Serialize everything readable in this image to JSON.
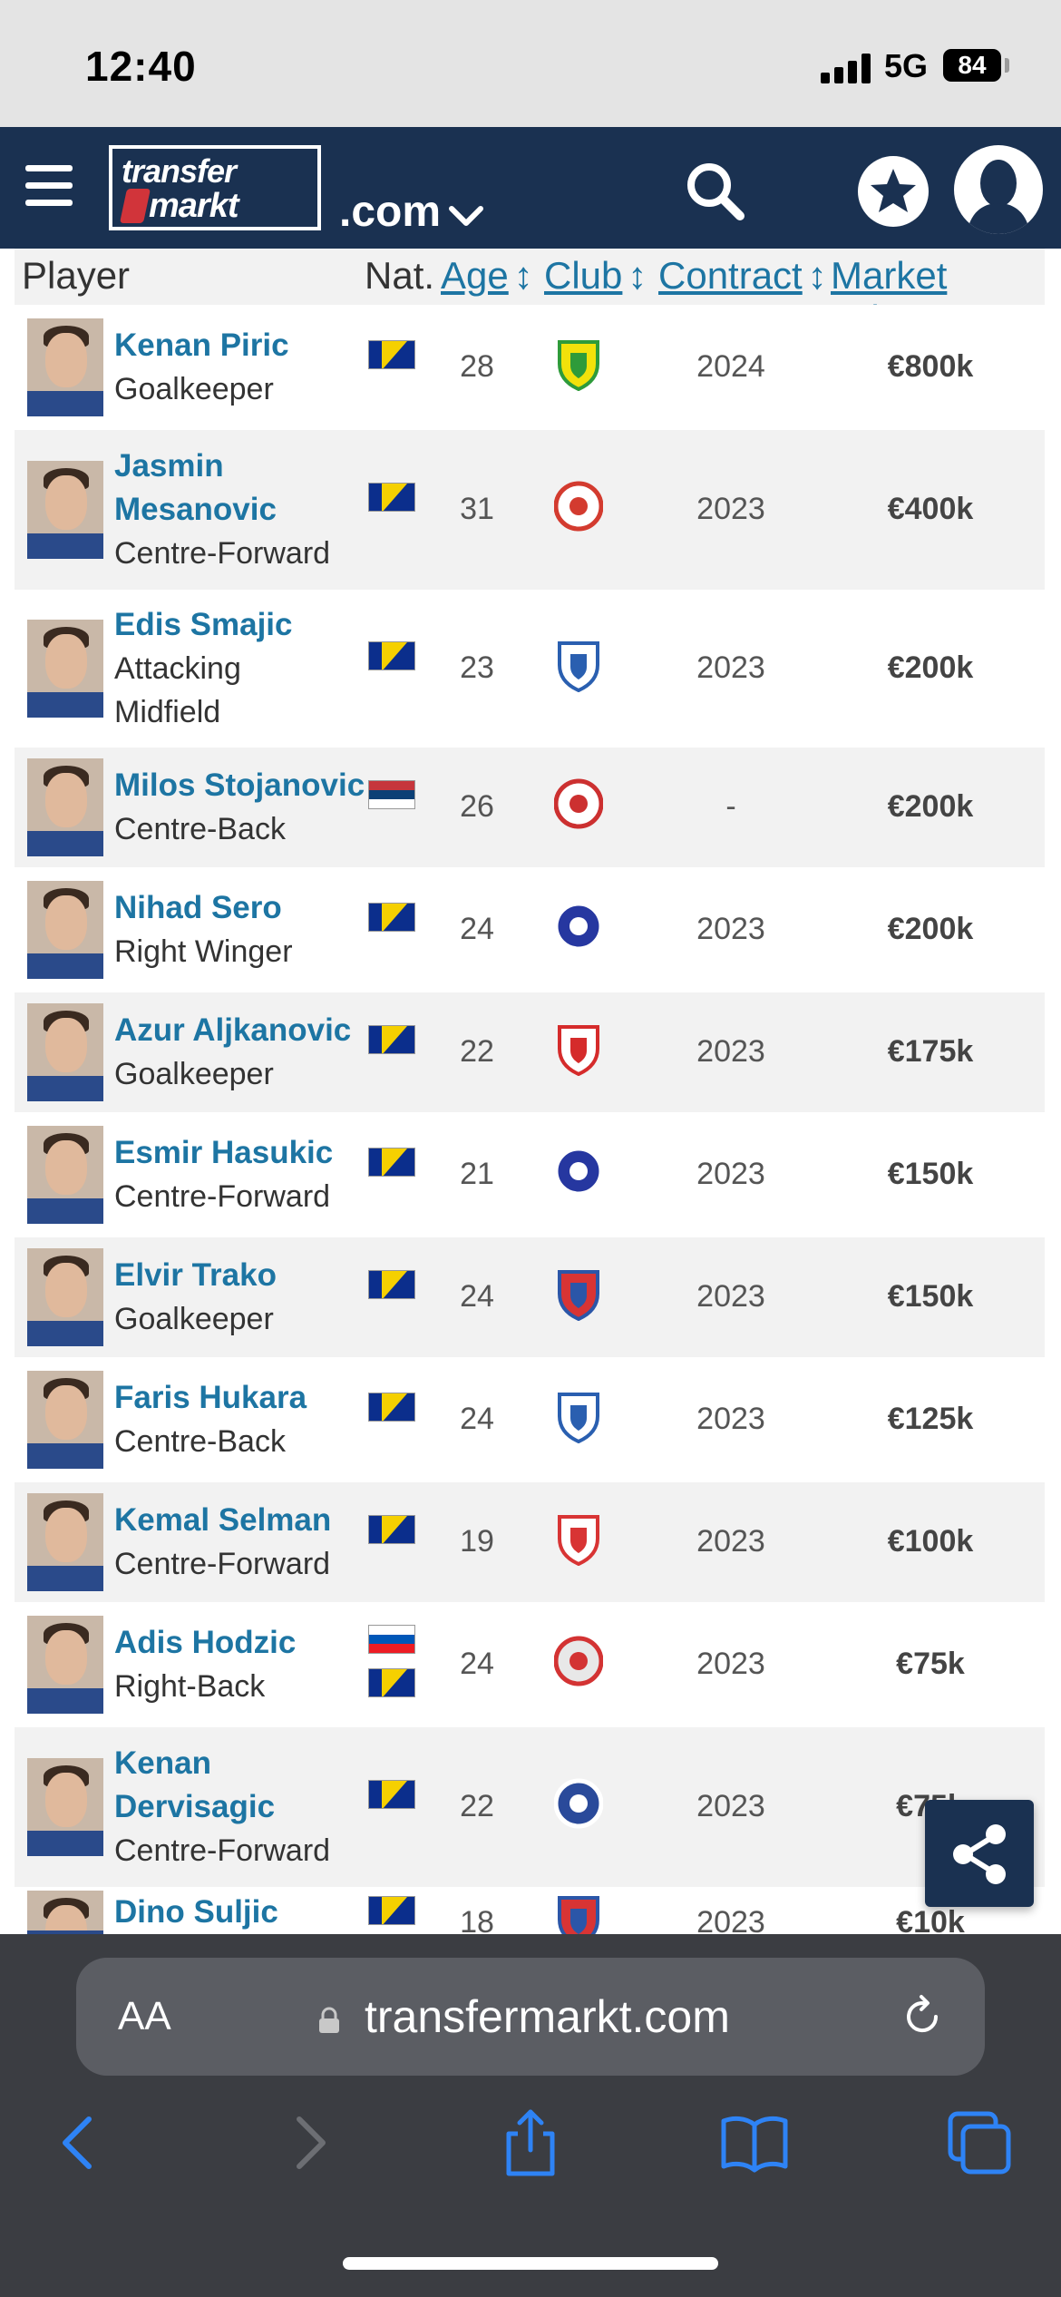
{
  "status_bar": {
    "time": "12:40",
    "network": "5G",
    "battery": "84"
  },
  "header": {
    "logo_line1": "transfer",
    "logo_line2": "markt",
    "tld": ".com"
  },
  "table": {
    "columns": {
      "player": "Player",
      "nat": "Nat.",
      "age": "Age",
      "club": "Club",
      "contract": "Contract",
      "market_value": "Market value"
    },
    "rows": [
      {
        "name": "Kenan Piric",
        "position": "Goalkeeper",
        "flags": [
          "bosnia"
        ],
        "age": "28",
        "crest": "green-yellow-crest-icon",
        "contract": "2024",
        "market_value": "€800k"
      },
      {
        "name": "Jasmin",
        "name2": "Mesanovic",
        "position": "Centre-Forward",
        "flags": [
          "bosnia"
        ],
        "age": "31",
        "crest": "red-round-crest-icon",
        "contract": "2023",
        "market_value": "€400k"
      },
      {
        "name": "Edis Smajic",
        "position": "Attacking",
        "position2": "Midfield",
        "flags": [
          "bosnia"
        ],
        "age": "23",
        "crest": "blue-shield-crest-icon",
        "contract": "2023",
        "market_value": "€200k"
      },
      {
        "name": "Milos Stojanovic",
        "position": "Centre-Back",
        "flags": [
          "serbia"
        ],
        "age": "26",
        "crest": "red-white-round-crest-icon",
        "contract": "-",
        "market_value": "€200k"
      },
      {
        "name": "Nihad Sero",
        "position": "Right Winger",
        "flags": [
          "bosnia"
        ],
        "age": "24",
        "crest": "blue-round-crest-icon",
        "contract": "2023",
        "market_value": "€200k"
      },
      {
        "name": "Azur Aljkanovic",
        "position": "Goalkeeper",
        "flags": [
          "bosnia"
        ],
        "age": "22",
        "crest": "red-white-striped-crest-icon",
        "contract": "2023",
        "market_value": "€175k"
      },
      {
        "name": "Esmir Hasukic",
        "position": "Centre-Forward",
        "flags": [
          "bosnia"
        ],
        "age": "21",
        "crest": "blue-round-crest-icon",
        "contract": "2023",
        "market_value": "€150k"
      },
      {
        "name": "Elvir Trako",
        "position": "Goalkeeper",
        "flags": [
          "bosnia"
        ],
        "age": "24",
        "crest": "red-blue-shield-crest-icon",
        "contract": "2023",
        "market_value": "€150k"
      },
      {
        "name": "Faris Hukara",
        "position": "Centre-Back",
        "flags": [
          "bosnia"
        ],
        "age": "24",
        "crest": "blue-shield-crest-icon",
        "contract": "2023",
        "market_value": "€125k"
      },
      {
        "name": "Kemal Selman",
        "position": "Centre-Forward",
        "flags": [
          "bosnia"
        ],
        "age": "19",
        "crest": "red-white-shield-crest-icon",
        "contract": "2023",
        "market_value": "€100k"
      },
      {
        "name": "Adis Hodzic",
        "position": "Right-Back",
        "flags": [
          "slovenia",
          "bosnia"
        ],
        "age": "24",
        "crest": "no-crest-icon",
        "contract": "2023",
        "market_value": "€75k"
      },
      {
        "name": "Kenan",
        "name2": "Dervisagic",
        "position": "Centre-Forward",
        "flags": [
          "bosnia"
        ],
        "age": "22",
        "crest": "blue-star-crest-icon",
        "contract": "2023",
        "market_value": "€75k"
      },
      {
        "name": "Dino Suljic",
        "position": "",
        "flags": [
          "bosnia"
        ],
        "age": "18",
        "crest": "red-blue-crest-icon",
        "contract": "2023",
        "market_value": "€10k"
      }
    ]
  },
  "safari": {
    "text_size": "AA",
    "url": "transfermarkt.com"
  },
  "colors": {
    "header_bg": "#1a3151",
    "link": "#1d75a3",
    "row_alt": "#f2f2f2"
  }
}
